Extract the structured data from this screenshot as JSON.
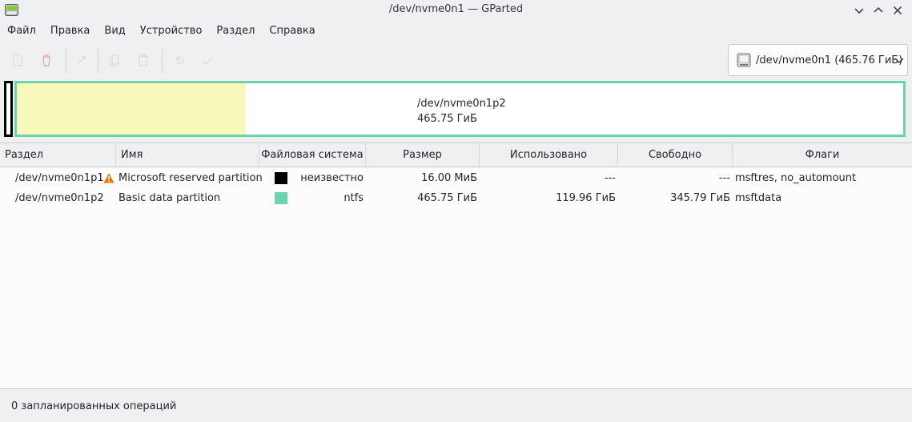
{
  "window": {
    "title": "/dev/nvme0n1 — GParted"
  },
  "menu": [
    "Файл",
    "Правка",
    "Вид",
    "Устройство",
    "Раздел",
    "Справка"
  ],
  "device_selector": {
    "label": "/dev/nvme0n1 (465.76 ГиБ)"
  },
  "disk_map": {
    "partition_name": "/dev/nvme0n1p2",
    "partition_size": "465.75 ГиБ",
    "used_fraction": 0.258,
    "partition_color": "#6bd3ae",
    "used_color": "#f8f8ba"
  },
  "table": {
    "columns": [
      "Раздел",
      "Имя",
      "Файловая система",
      "Размер",
      "Использовано",
      "Свободно",
      "Флаги"
    ],
    "rows": [
      {
        "partition": "/dev/nvme0n1p1",
        "warning": true,
        "name": "Microsoft reserved partition",
        "fs_color": "#000000",
        "filesystem": "неизвестно",
        "size": "16.00 МиБ",
        "used": "---",
        "free": "---",
        "flags": "msftres, no_automount"
      },
      {
        "partition": "/dev/nvme0n1p2",
        "warning": false,
        "name": "Basic data partition",
        "fs_color": "#6bd3ae",
        "filesystem": "ntfs",
        "size": "465.75 ГиБ",
        "used": "119.96 ГиБ",
        "free": "345.79 ГиБ",
        "flags": "msftdata"
      }
    ]
  },
  "status": {
    "text": "0 запланированных операций"
  }
}
